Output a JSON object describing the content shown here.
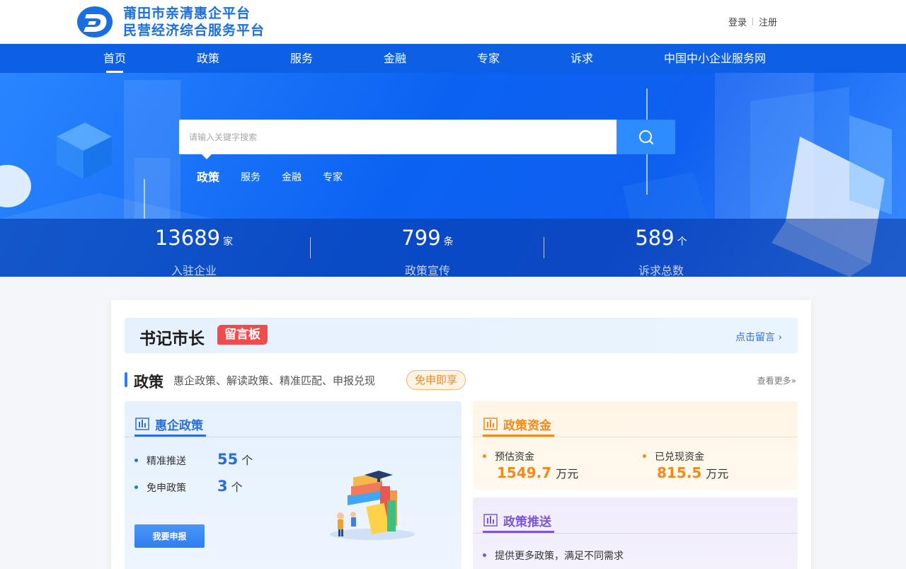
{
  "header": {
    "title_line1": "莆田市亲清惠企平台",
    "title_line2": "民营经济综合服务平台",
    "login": "登录",
    "register": "注册"
  },
  "nav": {
    "items": [
      {
        "label": "首页",
        "active": true
      },
      {
        "label": "政策"
      },
      {
        "label": "服务"
      },
      {
        "label": "金融"
      },
      {
        "label": "专家"
      },
      {
        "label": "诉求"
      },
      {
        "label": "中国中小企业服务网"
      }
    ]
  },
  "search": {
    "placeholder": "请输入关键字搜索",
    "tabs": [
      {
        "label": "政策",
        "active": true
      },
      {
        "label": "服务"
      },
      {
        "label": "金融"
      },
      {
        "label": "专家"
      }
    ]
  },
  "stats": [
    {
      "value": "13689",
      "unit": "家",
      "label": "入驻企业"
    },
    {
      "value": "799",
      "unit": "条",
      "label": "政策宣传"
    },
    {
      "value": "589",
      "unit": "个",
      "label": "诉求总数"
    }
  ],
  "banner": {
    "title": "书记市长",
    "badge": "留言板",
    "link": "点击留言 ›"
  },
  "policy_section": {
    "title": "政策",
    "desc": "惠企政策、解读政策、精准匹配、申报兑现",
    "pill": "免申即享",
    "more": "查看更多»"
  },
  "panel_hqzc": {
    "title": "惠企政策",
    "rows": [
      {
        "label": "精准推送",
        "value": "55",
        "unit": "个"
      },
      {
        "label": "免申政策",
        "value": "3",
        "unit": "个"
      }
    ],
    "button": "我要申报"
  },
  "panel_zczj": {
    "title": "政策资金",
    "items": [
      {
        "label": "预估资金",
        "value": "1549.7",
        "unit": "万元"
      },
      {
        "label": "已兑现资金",
        "value": "815.5",
        "unit": "万元"
      }
    ]
  },
  "panel_zcts": {
    "title": "政策推送",
    "text": "提供更多政策，满足不同需求"
  },
  "colors": {
    "brand": "#0d60e6",
    "accent_blue": "#2d7cf6",
    "accent_orange": "#f08a1b",
    "accent_purple": "#7a56d6",
    "badge_red": "#f24b4b"
  }
}
